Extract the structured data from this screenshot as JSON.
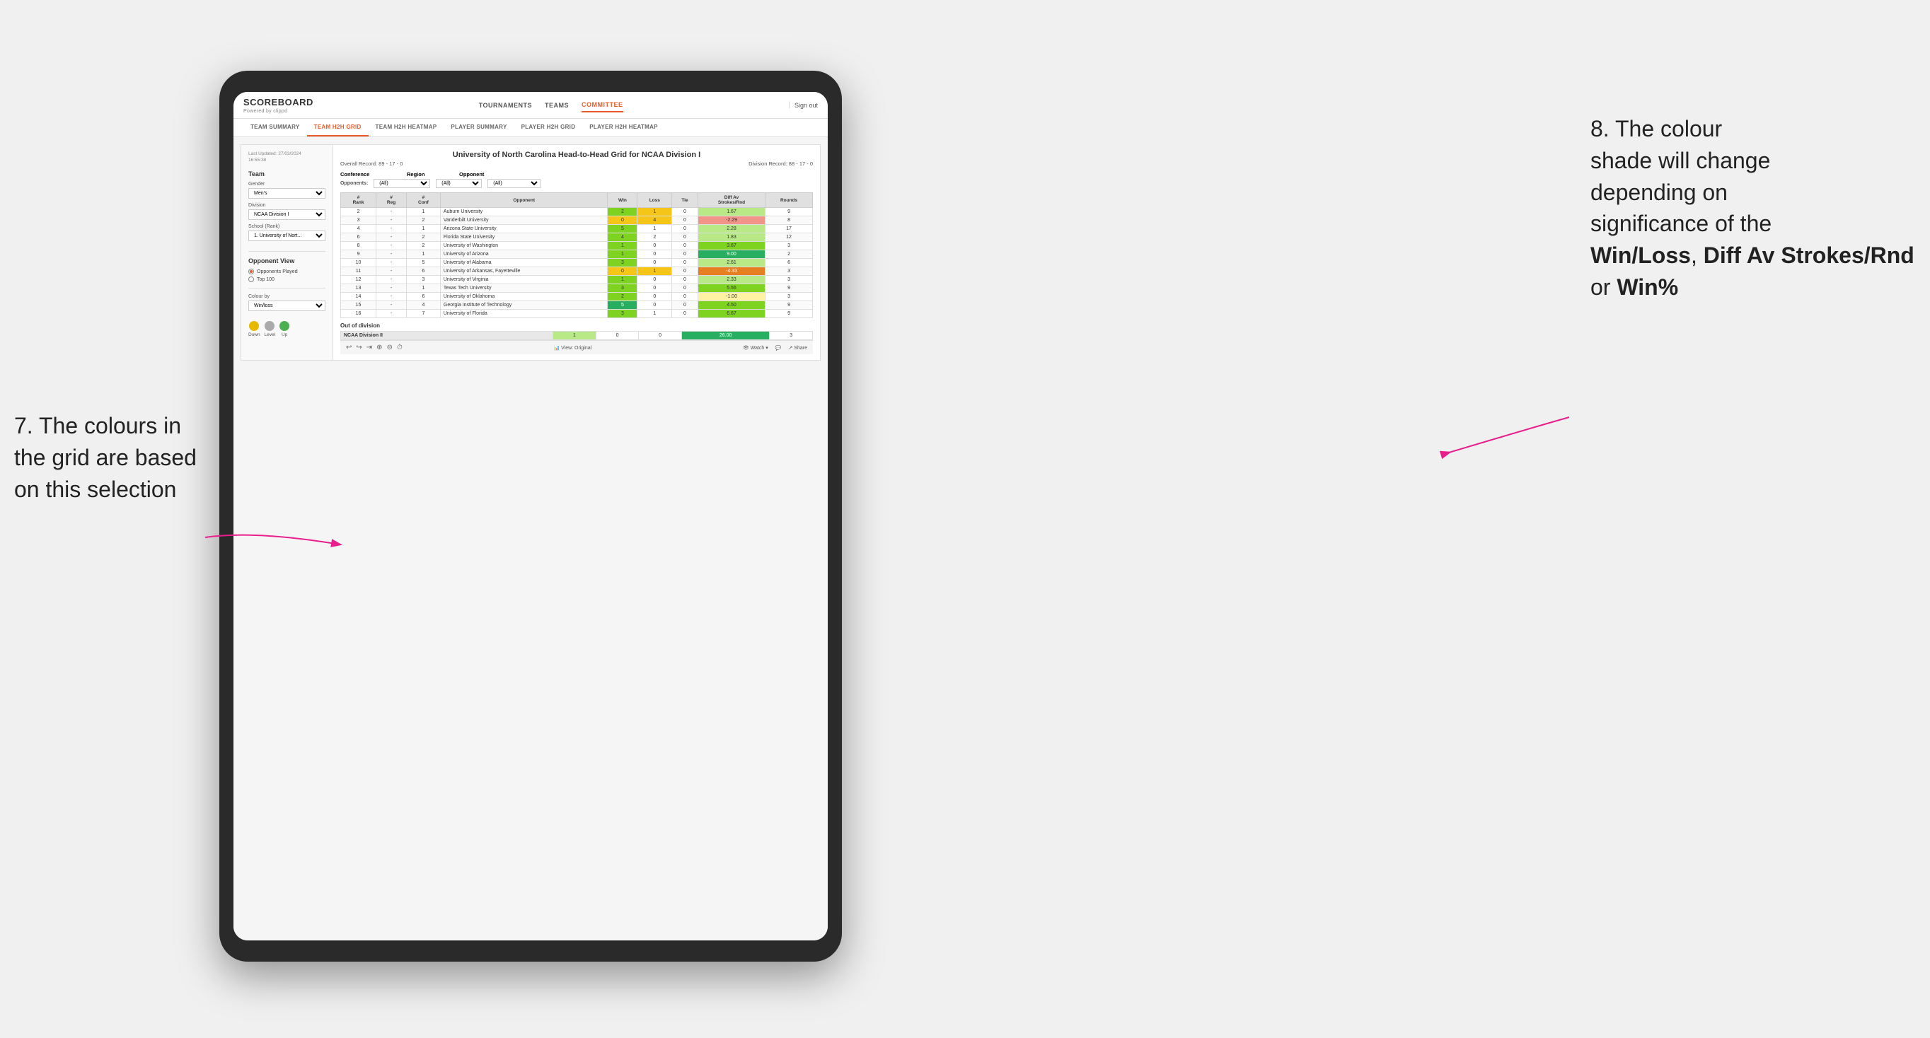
{
  "annotation_left": {
    "line1": "7. The colours in",
    "line2": "the grid are based",
    "line3": "on this selection"
  },
  "annotation_right": {
    "line1": "8. The colour",
    "line2": "shade will change",
    "line3": "depending on",
    "line4": "significance of the",
    "bold1": "Win/Loss",
    "bold2": "Diff Av Strokes/Rnd",
    "bold3": "Win%"
  },
  "app": {
    "logo": "SCOREBOARD",
    "logo_sub": "Powered by clippd",
    "nav": [
      "TOURNAMENTS",
      "TEAMS",
      "COMMITTEE"
    ],
    "sign_out": "Sign out",
    "sub_nav": [
      "TEAM SUMMARY",
      "TEAM H2H GRID",
      "TEAM H2H HEATMAP",
      "PLAYER SUMMARY",
      "PLAYER H2H GRID",
      "PLAYER H2H HEATMAP"
    ],
    "active_nav": "COMMITTEE",
    "active_sub_nav": "TEAM H2H GRID"
  },
  "sidebar": {
    "update_info": "Last Updated: 27/03/2024\n16:55:38",
    "team_label": "Team",
    "gender_label": "Gender",
    "gender_value": "Men's",
    "division_label": "Division",
    "division_value": "NCAA Division I",
    "school_label": "School (Rank)",
    "school_value": "1. University of Nort...",
    "opponent_view_label": "Opponent View",
    "radio_options": [
      "Opponents Played",
      "Top 100"
    ],
    "selected_radio": "Opponents Played",
    "colour_by_label": "Colour by",
    "colour_by_value": "Win/loss",
    "legend": {
      "down": "Down",
      "level": "Level",
      "up": "Up"
    }
  },
  "report": {
    "title": "University of North Carolina Head-to-Head Grid for NCAA Division I",
    "overall_record": "Overall Record: 89 - 17 - 0",
    "division_record": "Division Record: 88 - 17 - 0",
    "filters": {
      "conference_label": "Conference",
      "conference_value": "(All)",
      "region_label": "Region",
      "region_value": "(All)",
      "opponent_label": "Opponent",
      "opponent_value": "(All)",
      "opponents_label": "Opponents:"
    },
    "col_headers": [
      "#\nRank",
      "#\nReg",
      "#\nConf",
      "Opponent",
      "Win",
      "Loss",
      "Tie",
      "Diff Av\nStrokes/Rnd",
      "Rounds"
    ],
    "rows": [
      {
        "rank": "2",
        "reg": "-",
        "conf": "1",
        "opponent": "Auburn University",
        "win": "2",
        "loss": "1",
        "tie": "0",
        "diff": "1.67",
        "rounds": "9",
        "win_color": "green",
        "loss_color": "yellow",
        "diff_color": "green-light"
      },
      {
        "rank": "3",
        "reg": "-",
        "conf": "2",
        "opponent": "Vanderbilt University",
        "win": "0",
        "loss": "4",
        "tie": "0",
        "diff": "-2.29",
        "rounds": "8",
        "win_color": "yellow",
        "loss_color": "yellow",
        "diff_color": "red-light"
      },
      {
        "rank": "4",
        "reg": "-",
        "conf": "1",
        "opponent": "Arizona State University",
        "win": "5",
        "loss": "1",
        "tie": "0",
        "diff": "2.28",
        "rounds": "17",
        "win_color": "green",
        "loss_color": "white",
        "diff_color": "green-light"
      },
      {
        "rank": "6",
        "reg": "-",
        "conf": "2",
        "opponent": "Florida State University",
        "win": "4",
        "loss": "2",
        "tie": "0",
        "diff": "1.83",
        "rounds": "12",
        "win_color": "green",
        "loss_color": "white",
        "diff_color": "green-light"
      },
      {
        "rank": "8",
        "reg": "-",
        "conf": "2",
        "opponent": "University of Washington",
        "win": "1",
        "loss": "0",
        "tie": "0",
        "diff": "3.67",
        "rounds": "3",
        "win_color": "green",
        "loss_color": "white",
        "diff_color": "green"
      },
      {
        "rank": "9",
        "reg": "-",
        "conf": "1",
        "opponent": "University of Arizona",
        "win": "1",
        "loss": "0",
        "tie": "0",
        "diff": "9.00",
        "rounds": "2",
        "win_color": "green",
        "loss_color": "white",
        "diff_color": "green-dark"
      },
      {
        "rank": "10",
        "reg": "-",
        "conf": "5",
        "opponent": "University of Alabama",
        "win": "3",
        "loss": "0",
        "tie": "0",
        "diff": "2.61",
        "rounds": "6",
        "win_color": "green",
        "loss_color": "white",
        "diff_color": "green-light"
      },
      {
        "rank": "11",
        "reg": "-",
        "conf": "6",
        "opponent": "University of Arkansas, Fayetteville",
        "win": "0",
        "loss": "1",
        "tie": "0",
        "diff": "-4.33",
        "rounds": "3",
        "win_color": "yellow",
        "loss_color": "yellow",
        "diff_color": "orange"
      },
      {
        "rank": "12",
        "reg": "-",
        "conf": "3",
        "opponent": "University of Virginia",
        "win": "1",
        "loss": "0",
        "tie": "0",
        "diff": "2.33",
        "rounds": "3",
        "win_color": "green",
        "loss_color": "white",
        "diff_color": "green-light"
      },
      {
        "rank": "13",
        "reg": "-",
        "conf": "1",
        "opponent": "Texas Tech University",
        "win": "3",
        "loss": "0",
        "tie": "0",
        "diff": "5.56",
        "rounds": "9",
        "win_color": "green",
        "loss_color": "white",
        "diff_color": "green"
      },
      {
        "rank": "14",
        "reg": "-",
        "conf": "6",
        "opponent": "University of Oklahoma",
        "win": "2",
        "loss": "0",
        "tie": "0",
        "diff": "-1.00",
        "rounds": "3",
        "win_color": "green",
        "loss_color": "white",
        "diff_color": "yellow-light"
      },
      {
        "rank": "15",
        "reg": "-",
        "conf": "4",
        "opponent": "Georgia Institute of Technology",
        "win": "5",
        "loss": "0",
        "tie": "0",
        "diff": "4.50",
        "rounds": "9",
        "win_color": "green-dark",
        "loss_color": "white",
        "diff_color": "green"
      },
      {
        "rank": "16",
        "reg": "-",
        "conf": "7",
        "opponent": "University of Florida",
        "win": "3",
        "loss": "1",
        "tie": "0",
        "diff": "6.67",
        "rounds": "9",
        "win_color": "green",
        "loss_color": "white",
        "diff_color": "green"
      }
    ],
    "out_of_division_label": "Out of division",
    "out_of_division_row": {
      "division": "NCAA Division II",
      "win": "1",
      "loss": "0",
      "tie": "0",
      "diff": "26.00",
      "rounds": "3",
      "diff_color": "green-dark"
    }
  },
  "toolbar": {
    "view_label": "View: Original",
    "watch_label": "Watch ▾",
    "share_label": "Share"
  }
}
